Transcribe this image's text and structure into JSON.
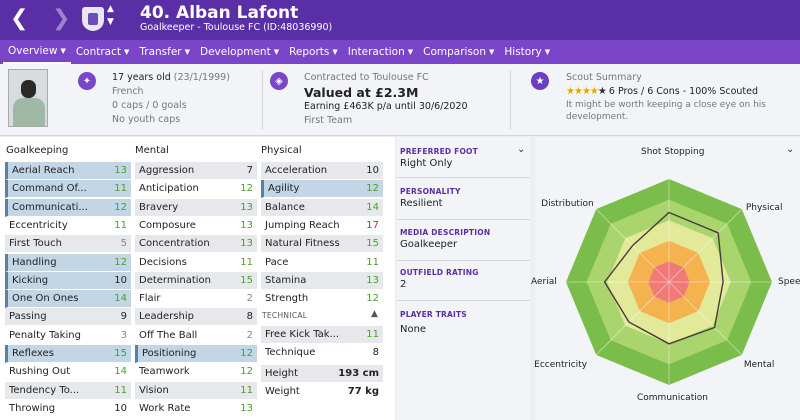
{
  "header": {
    "title": "40. Alban Lafont",
    "subtitle": "Goalkeeper - Toulouse FC (ID:48036990)"
  },
  "menu": [
    {
      "label": "Overview",
      "active": true
    },
    {
      "label": "Contract"
    },
    {
      "label": "Transfer"
    },
    {
      "label": "Development"
    },
    {
      "label": "Reports"
    },
    {
      "label": "Interaction"
    },
    {
      "label": "Comparison"
    },
    {
      "label": "History"
    }
  ],
  "info": {
    "age": "17 years old",
    "dob": "(23/1/1999)",
    "nationality": "French",
    "caps": "0 caps / 0 goals",
    "youth_caps": "No youth caps",
    "contract": "Contracted to Toulouse FC",
    "value": "Valued at £2.3M",
    "earning": "Earning £463K p/a until 30/6/2020",
    "squad": "First Team",
    "scout_title": "Scout Summary",
    "stars_filled": 4,
    "stars_total": 5,
    "scout_summary": "6 Pros / 6 Cons - 100% Scouted",
    "scout_note_1": "It might be worth keeping a close eye on his",
    "scout_note_2": "development."
  },
  "sections": {
    "goalkeeping": "Goalkeeping",
    "mental": "Mental",
    "physical": "Physical",
    "technical": "TECHNICAL"
  },
  "goalkeeping": [
    {
      "name": "Aerial Reach",
      "value": "13",
      "color": "green",
      "hl": true
    },
    {
      "name": "Command Of...",
      "value": "11",
      "color": "green",
      "hl": true
    },
    {
      "name": "Communicati...",
      "value": "12",
      "color": "green",
      "hl": true
    },
    {
      "name": "Eccentricity",
      "value": "11",
      "color": "green"
    },
    {
      "name": "First Touch",
      "value": "5",
      "color": "grey"
    },
    {
      "name": "Handling",
      "value": "12",
      "color": "green",
      "hl": true
    },
    {
      "name": "Kicking",
      "value": "10",
      "color": "black",
      "hl": true
    },
    {
      "name": "One On Ones",
      "value": "14",
      "color": "green",
      "hl": true
    },
    {
      "name": "Passing",
      "value": "9",
      "color": "black"
    },
    {
      "name": "Penalty Taking",
      "value": "3",
      "color": "grey"
    },
    {
      "name": "Reflexes",
      "value": "15",
      "color": "green",
      "hl": true
    },
    {
      "name": "Rushing Out",
      "value": "14",
      "color": "green"
    },
    {
      "name": "Tendency To...",
      "value": "11",
      "color": "green"
    },
    {
      "name": "Throwing",
      "value": "10",
      "color": "black"
    }
  ],
  "mental": [
    {
      "name": "Aggression",
      "value": "7",
      "color": "black"
    },
    {
      "name": "Anticipation",
      "value": "12",
      "color": "green"
    },
    {
      "name": "Bravery",
      "value": "13",
      "color": "green"
    },
    {
      "name": "Composure",
      "value": "13",
      "color": "green"
    },
    {
      "name": "Concentration",
      "value": "13",
      "color": "green"
    },
    {
      "name": "Decisions",
      "value": "11",
      "color": "green"
    },
    {
      "name": "Determination",
      "value": "15",
      "color": "green"
    },
    {
      "name": "Flair",
      "value": "2",
      "color": "grey"
    },
    {
      "name": "Leadership",
      "value": "8",
      "color": "black"
    },
    {
      "name": "Off The Ball",
      "value": "2",
      "color": "grey"
    },
    {
      "name": "Positioning",
      "value": "12",
      "color": "green",
      "hl": true
    },
    {
      "name": "Teamwork",
      "value": "12",
      "color": "green"
    },
    {
      "name": "Vision",
      "value": "11",
      "color": "green"
    },
    {
      "name": "Work Rate",
      "value": "13",
      "color": "green"
    }
  ],
  "physical": [
    {
      "name": "Acceleration",
      "value": "10",
      "color": "black"
    },
    {
      "name": "Agility",
      "value": "12",
      "color": "green",
      "hl": true
    },
    {
      "name": "Balance",
      "value": "14",
      "color": "green"
    },
    {
      "name": "Jumping Reach",
      "value": "17",
      "color": "red"
    },
    {
      "name": "Natural Fitness",
      "value": "15",
      "color": "green"
    },
    {
      "name": "Pace",
      "value": "11",
      "color": "green"
    },
    {
      "name": "Stamina",
      "value": "13",
      "color": "green"
    },
    {
      "name": "Strength",
      "value": "12",
      "color": "green"
    }
  ],
  "technical": [
    {
      "name": "Free Kick Tak...",
      "value": "11",
      "color": "green"
    },
    {
      "name": "Technique",
      "value": "8",
      "color": "black"
    }
  ],
  "body": [
    {
      "name": "Height",
      "value": "193 cm"
    },
    {
      "name": "Weight",
      "value": "77 kg"
    }
  ],
  "details": {
    "foot_label": "PREFERRED FOOT",
    "foot_value": "Right Only",
    "personality_label": "PERSONALITY",
    "personality_value": "Resilient",
    "media_label": "MEDIA DESCRIPTION",
    "media_value": "Goalkeeper",
    "outfield_label": "OUTFIELD RATING",
    "outfield_value": "2",
    "traits_label": "PLAYER TRAITS",
    "traits_value": "None"
  },
  "radar": {
    "axes": [
      "Shot Stopping",
      "Physical",
      "Speed",
      "Mental",
      "Communication",
      "Eccentricity",
      "Aerial",
      "Distribution"
    ],
    "values": [
      13.5,
      13.5,
      10.5,
      12.5,
      12,
      11,
      12.5,
      10
    ],
    "max": 20,
    "band_colors": [
      "#7bbd4a",
      "#a9d46e",
      "#e2ea9a",
      "#f5b350",
      "#f07a78"
    ]
  },
  "colors": {
    "header": "#5a2fa6",
    "menu": "#7b45c9",
    "green": "#4aa02c",
    "red": "#d9211f"
  }
}
